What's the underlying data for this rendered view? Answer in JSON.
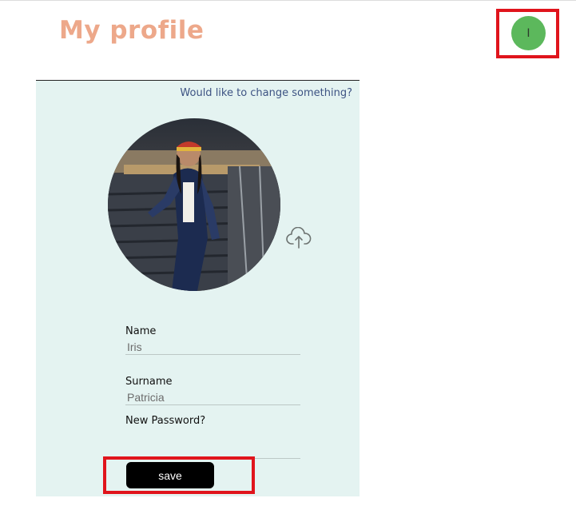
{
  "header": {
    "title": "My profile",
    "avatar_initial": "I",
    "avatar_color": "#5cb85c",
    "title_color": "#eda88a"
  },
  "highlight_color": "#e0141c",
  "card": {
    "background": "#e4f3f1",
    "change_link": "Would like to change something?",
    "photo": "profile-photo",
    "upload_icon": "cloud-upload-icon",
    "fields": [
      {
        "label": "Name",
        "value": "Iris"
      },
      {
        "label": "Surname",
        "value": "Patricia"
      },
      {
        "label": "New Password?",
        "value": ""
      }
    ],
    "save_label": "save"
  }
}
